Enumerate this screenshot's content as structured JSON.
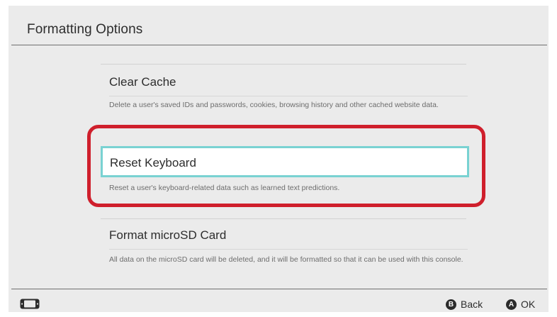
{
  "header": {
    "title": "Formatting Options"
  },
  "options": [
    {
      "title": "Clear Cache",
      "description": "Delete a user's saved IDs and passwords, cookies, browsing history and other cached website data."
    },
    {
      "title": "Reset Keyboard",
      "description": "Reset a user's keyboard-related data such as learned text predictions.",
      "selected": true
    },
    {
      "title": "Format microSD Card",
      "description": "All data on the microSD card will be deleted, and it will be formatted so that it can be used with this console."
    }
  ],
  "footer": {
    "back": {
      "glyph": "B",
      "label": "Back"
    },
    "ok": {
      "glyph": "A",
      "label": "OK"
    },
    "left_icon": "console-icon"
  },
  "colors": {
    "focus_border": "#79d2d2",
    "annotation": "#cf1f2c",
    "background": "#ebebeb"
  }
}
